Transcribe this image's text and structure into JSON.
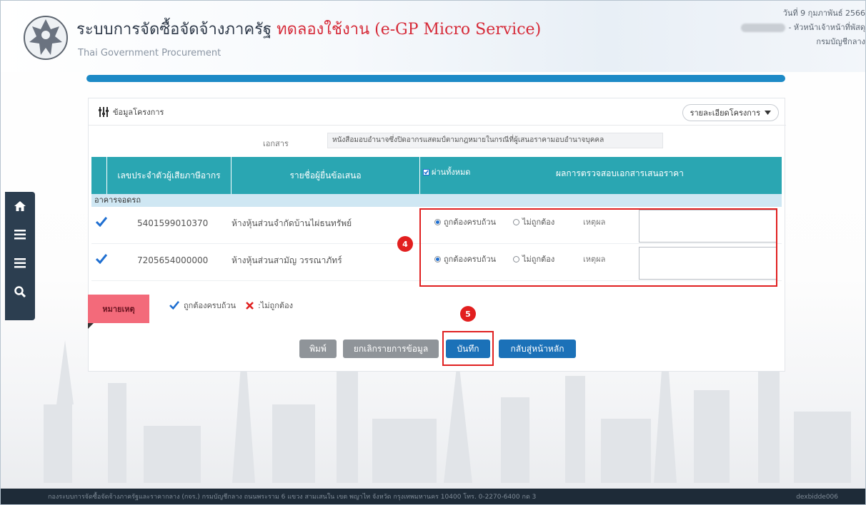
{
  "header": {
    "title_main": "ระบบการจัดซื้อจัดจ้างภาครัฐ",
    "title_test": "ทดลองใช้งาน (e-GP Micro Service)",
    "subtitle": "Thai Government Procurement",
    "date": "วันที่ 9 กุมภาพันธ์ 2566",
    "role": "- หัวหน้าเจ้าหน้าที่พัสดุ",
    "department": "กรมบัญชีกลาง"
  },
  "nav": {
    "icons": [
      "home-icon",
      "menu-icon",
      "menu-icon",
      "search-icon"
    ]
  },
  "panel": {
    "title": "ข้อมูลโครงการ",
    "detail_button": "รายละเอียดโครงการ",
    "doc_label": "เอกสาร",
    "doc_value": "หนังสือมอบอำนาจซึ่งปิดอากรแสตมป์ตามกฎหมายในกรณีที่ผู้เสนอราคามอบอำนาจบุคคล"
  },
  "table": {
    "col_tax": "เลขประจำตัวผู้เสียภาษีอากร",
    "col_name": "รายชื่อผู้ยื่นข้อเสนอ",
    "col_select_all": "ผ่านทั้งหมด",
    "col_result": "ผลการตรวจสอบเอกสารเสนอราคา",
    "group": "อาคารจอดรถ",
    "option_correct": "ถูกต้องครบถ้วน",
    "option_incorrect": "ไม่ถูกต้อง",
    "reason_label": "เหตุผล",
    "rows": [
      {
        "tax_id": "5401599010370",
        "name": "ห้างหุ้นส่วนจำกัดบ้านไผ่ธนทรัพย์",
        "selected": "correct",
        "reason": ""
      },
      {
        "tax_id": "7205654000000",
        "name": "ห้างหุ้นส่วนสามัญ วรรณาภัทร์",
        "selected": "correct",
        "reason": ""
      }
    ]
  },
  "annotations": {
    "step4": "4",
    "step5": "5"
  },
  "legend": {
    "note_label": "หมายเหตุ",
    "correct": "ถูกต้องครบถ้วน",
    "incorrect": ":ไม่ถูกต้อง"
  },
  "buttons": {
    "print": "พิมพ์",
    "cancel": "ยกเลิกรายการข้อมูล",
    "save": "บันทึก",
    "back": "กลับสู่หน้าหลัก"
  },
  "footer": {
    "address": "กองระบบการจัดซื้อจัดจ้างภาครัฐและราคากลาง (กจร.) กรมบัญชีกลาง ถนนพระราม 6 แขวง สามเสนใน เขต พญาไท จังหวัด กรุงเทพมหานคร 10400 โทร. 0-2270-6400 กด 3",
    "server": "dexbidde006"
  },
  "colors": {
    "accent": "#1d8ac6",
    "table_header": "#2aa6b2",
    "highlight": "#e02020",
    "nav_bg": "#2c3e50"
  }
}
